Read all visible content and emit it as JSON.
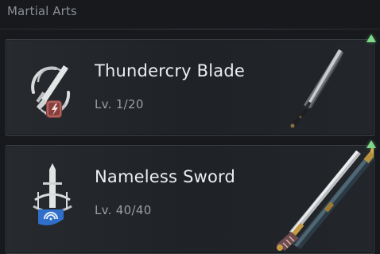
{
  "section": {
    "title": "Martial Arts"
  },
  "skills": [
    {
      "name": "Thundercry Blade",
      "level": "Lv. 1/20",
      "badge_color": "#8a3f3c",
      "icon": "blade-skill-icon",
      "weapon": "dark-blade-image",
      "upgrade_available": true
    },
    {
      "name": "Nameless Sword",
      "level": "Lv. 40/40",
      "badge_color": "#2f6fc9",
      "icon": "sword-skill-icon",
      "weapon": "ornate-sword-image",
      "upgrade_available": true
    }
  ],
  "colors": {
    "background": "#17191c",
    "card": "#1f2226",
    "border": "#3b3f45",
    "upgrade_arrow": "#7fd88a"
  }
}
